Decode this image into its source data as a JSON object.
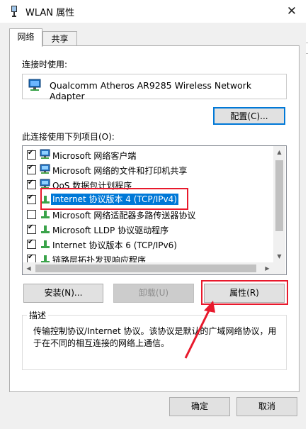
{
  "window": {
    "title": "WLAN 属性",
    "close_symbol": "✕"
  },
  "tabs": [
    {
      "label": "网络",
      "active": true
    },
    {
      "label": "共享",
      "active": false
    }
  ],
  "connect_using": {
    "label": "连接时使用:",
    "adapter_name": "Qualcomm Atheros AR9285 Wireless Network Adapter",
    "configure_label": "配置(C)..."
  },
  "items_section": {
    "label": "此连接使用下列项目(O):",
    "items": [
      {
        "label": "Microsoft 网络客户端",
        "checked": true,
        "icon": "network-client-icon"
      },
      {
        "label": "Microsoft 网络的文件和打印机共享",
        "checked": true,
        "icon": "network-client-icon"
      },
      {
        "label": "QoS 数据包计划程序",
        "checked": true,
        "icon": "network-client-icon"
      },
      {
        "label": "Internet 协议版本 4 (TCP/IPv4)",
        "checked": true,
        "icon": "protocol-icon",
        "selected": true
      },
      {
        "label": "Microsoft 网络适配器多路传送器协议",
        "checked": false,
        "icon": "protocol-icon"
      },
      {
        "label": "Microsoft LLDP 协议驱动程序",
        "checked": true,
        "icon": "protocol-icon"
      },
      {
        "label": "Internet 协议版本 6 (TCP/IPv6)",
        "checked": true,
        "icon": "protocol-icon"
      },
      {
        "label": "链路层拓扑发现响应程序",
        "checked": true,
        "icon": "protocol-icon"
      }
    ]
  },
  "actions": {
    "install_label": "安装(N)...",
    "uninstall_label": "卸载(U)",
    "properties_label": "属性(R)"
  },
  "description": {
    "title": "描述",
    "text": "传输控制协议/Internet 协议。该协议是默认的广域网络协议，用于在不同的相互连接的网络上通信。"
  },
  "footer": {
    "ok_label": "确定",
    "cancel_label": "取消"
  },
  "colors": {
    "selection": "#0078d7",
    "annotation_red": "#e8192c",
    "button_face": "#e1e1e1"
  }
}
